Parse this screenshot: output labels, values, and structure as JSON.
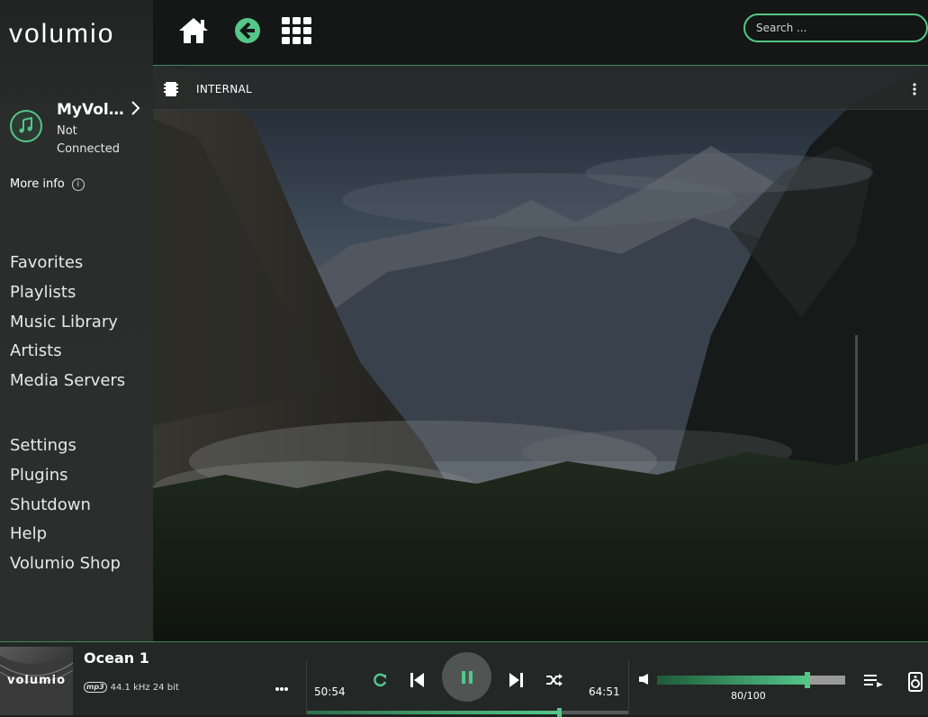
{
  "brand": {
    "logo_text": "volumio"
  },
  "colors": {
    "accent": "#54c688",
    "sidebar": "#2b2e2c",
    "topbar": "#151716"
  },
  "device": {
    "name": "MyVolumio",
    "status": "Not Connected",
    "more_info": "More info",
    "icon": "music-note-icon"
  },
  "nav_primary": [
    "Favorites",
    "Playlists",
    "Music Library",
    "Artists",
    "Media Servers"
  ],
  "nav_secondary": [
    "Settings",
    "Plugins",
    "Shutdown",
    "Help",
    "Volumio Shop"
  ],
  "topbar": {
    "icons": [
      "home-icon",
      "back-arrow-icon",
      "grid-icon"
    ],
    "search_placeholder": "Search ..."
  },
  "breadcrumb": {
    "icon": "sd-card-icon",
    "label": "INTERNAL",
    "menu_icon": "kebab-menu-icon"
  },
  "player": {
    "cover_text": "volumio",
    "title": "Ocean 1",
    "format_badge": "mp3",
    "format": "44.1 kHz 24 bit",
    "elapsed": "50:54",
    "duration": "64:51",
    "progress_fraction": 0.785,
    "volume": 80,
    "volume_label": "80/100",
    "state": "playing"
  }
}
